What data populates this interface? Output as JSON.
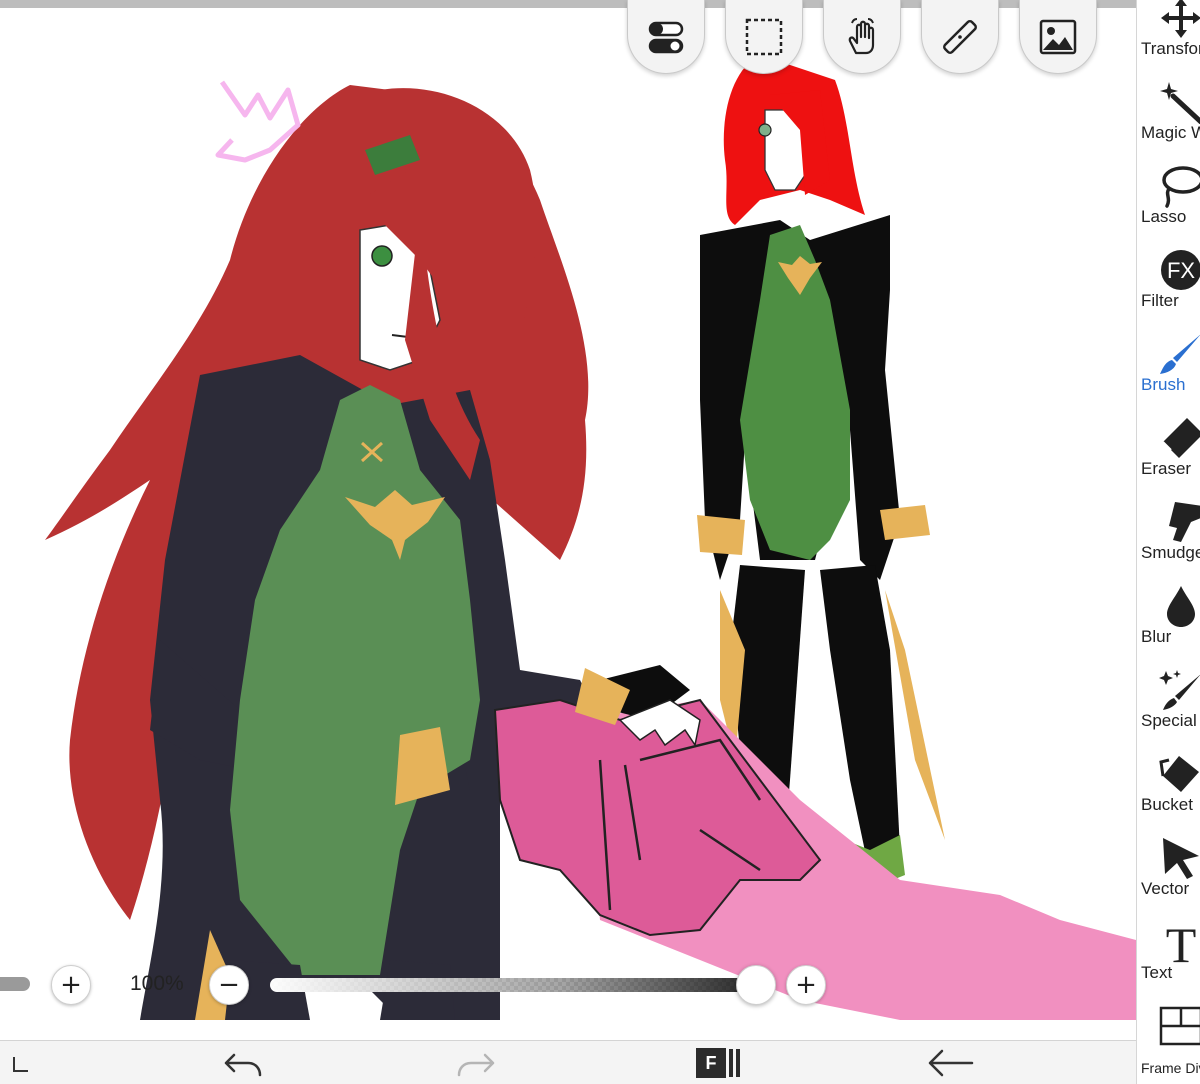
{
  "top_toolbar": {
    "buttons": [
      {
        "name": "toggle-icon"
      },
      {
        "name": "selection-icon"
      },
      {
        "name": "hand-icon"
      },
      {
        "name": "ruler-icon"
      },
      {
        "name": "image-icon"
      }
    ]
  },
  "tool_panel": {
    "active_color": "#2a6fd0",
    "items": [
      {
        "label": "Transform",
        "icon": "move-arrows-icon"
      },
      {
        "label": "Magic Wand",
        "icon": "magic-wand-icon"
      },
      {
        "label": "Lasso",
        "icon": "lasso-icon"
      },
      {
        "label": "Filter",
        "icon": "fx-icon",
        "glyph": "FX"
      },
      {
        "label": "Brush",
        "icon": "brush-icon",
        "active": true
      },
      {
        "label": "Eraser",
        "icon": "eraser-icon"
      },
      {
        "label": "Smudge",
        "icon": "smudge-icon"
      },
      {
        "label": "Blur",
        "icon": "blur-drop-icon"
      },
      {
        "label": "Special Brush",
        "icon": "special-brush-icon"
      },
      {
        "label": "Bucket",
        "icon": "bucket-icon"
      },
      {
        "label": "Vector",
        "icon": "vector-cursor-icon"
      },
      {
        "label": "Text",
        "icon": "text-icon",
        "glyph": "T"
      },
      {
        "label": "Frame Divider",
        "icon": "frame-divider-icon"
      }
    ]
  },
  "zoom_bar": {
    "plus_left": "+",
    "zoom_label": "100%",
    "minus": "−",
    "plus_right": "+",
    "opacity_level": 1.0
  },
  "bottom_bar": {
    "frame_badge": "F",
    "icons": [
      "chevron-down-icon",
      "undo-icon",
      "redo-icon",
      "frame-layers-icon",
      "back-icon"
    ]
  },
  "colors": {
    "hair": "#b83232",
    "hair_bright": "#ee1111",
    "jacket": "#2c2b38",
    "jacket_right": "#0d0d0d",
    "suit": "#5a8f55",
    "suit_right": "#4e8f43",
    "cuff": "#e6b35a",
    "sword": "#dd5b98",
    "sword_light": "#f190c0",
    "crown": "#f6b6ee"
  }
}
